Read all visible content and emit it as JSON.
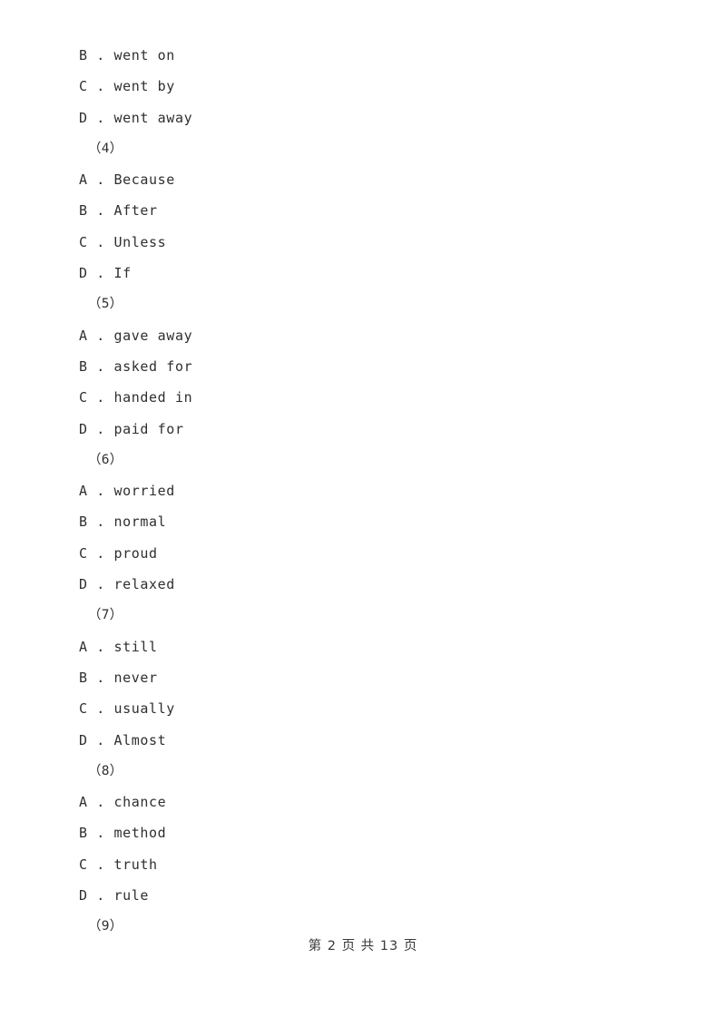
{
  "document": {
    "page_number": 2,
    "total_pages": 13,
    "footer_text": "第 2 页 共 13 页",
    "background_color": "#ffffff",
    "text_color": "#2f2f2f"
  },
  "lines": [
    {
      "kind": "option",
      "text": "B . went on"
    },
    {
      "kind": "option",
      "text": "C . went by"
    },
    {
      "kind": "option",
      "text": "D . went away"
    },
    {
      "kind": "qnum",
      "text": "（4）"
    },
    {
      "kind": "option",
      "text": "A . Because"
    },
    {
      "kind": "option",
      "text": "B . After"
    },
    {
      "kind": "option",
      "text": "C . Unless"
    },
    {
      "kind": "option",
      "text": "D . If"
    },
    {
      "kind": "qnum",
      "text": "（5）"
    },
    {
      "kind": "option",
      "text": "A . gave away"
    },
    {
      "kind": "option",
      "text": "B . asked for"
    },
    {
      "kind": "option",
      "text": "C . handed in"
    },
    {
      "kind": "option",
      "text": "D . paid for"
    },
    {
      "kind": "qnum",
      "text": "（6）"
    },
    {
      "kind": "option",
      "text": "A . worried"
    },
    {
      "kind": "option",
      "text": "B . normal"
    },
    {
      "kind": "option",
      "text": "C . proud"
    },
    {
      "kind": "option",
      "text": "D . relaxed"
    },
    {
      "kind": "qnum",
      "text": "（7）"
    },
    {
      "kind": "option",
      "text": "A . still"
    },
    {
      "kind": "option",
      "text": "B . never"
    },
    {
      "kind": "option",
      "text": "C . usually"
    },
    {
      "kind": "option",
      "text": "D . Almost"
    },
    {
      "kind": "qnum",
      "text": "（8）"
    },
    {
      "kind": "option",
      "text": "A . chance"
    },
    {
      "kind": "option",
      "text": "B . method"
    },
    {
      "kind": "option",
      "text": "C . truth"
    },
    {
      "kind": "option",
      "text": "D . rule"
    },
    {
      "kind": "qnum",
      "text": "（9）"
    }
  ]
}
